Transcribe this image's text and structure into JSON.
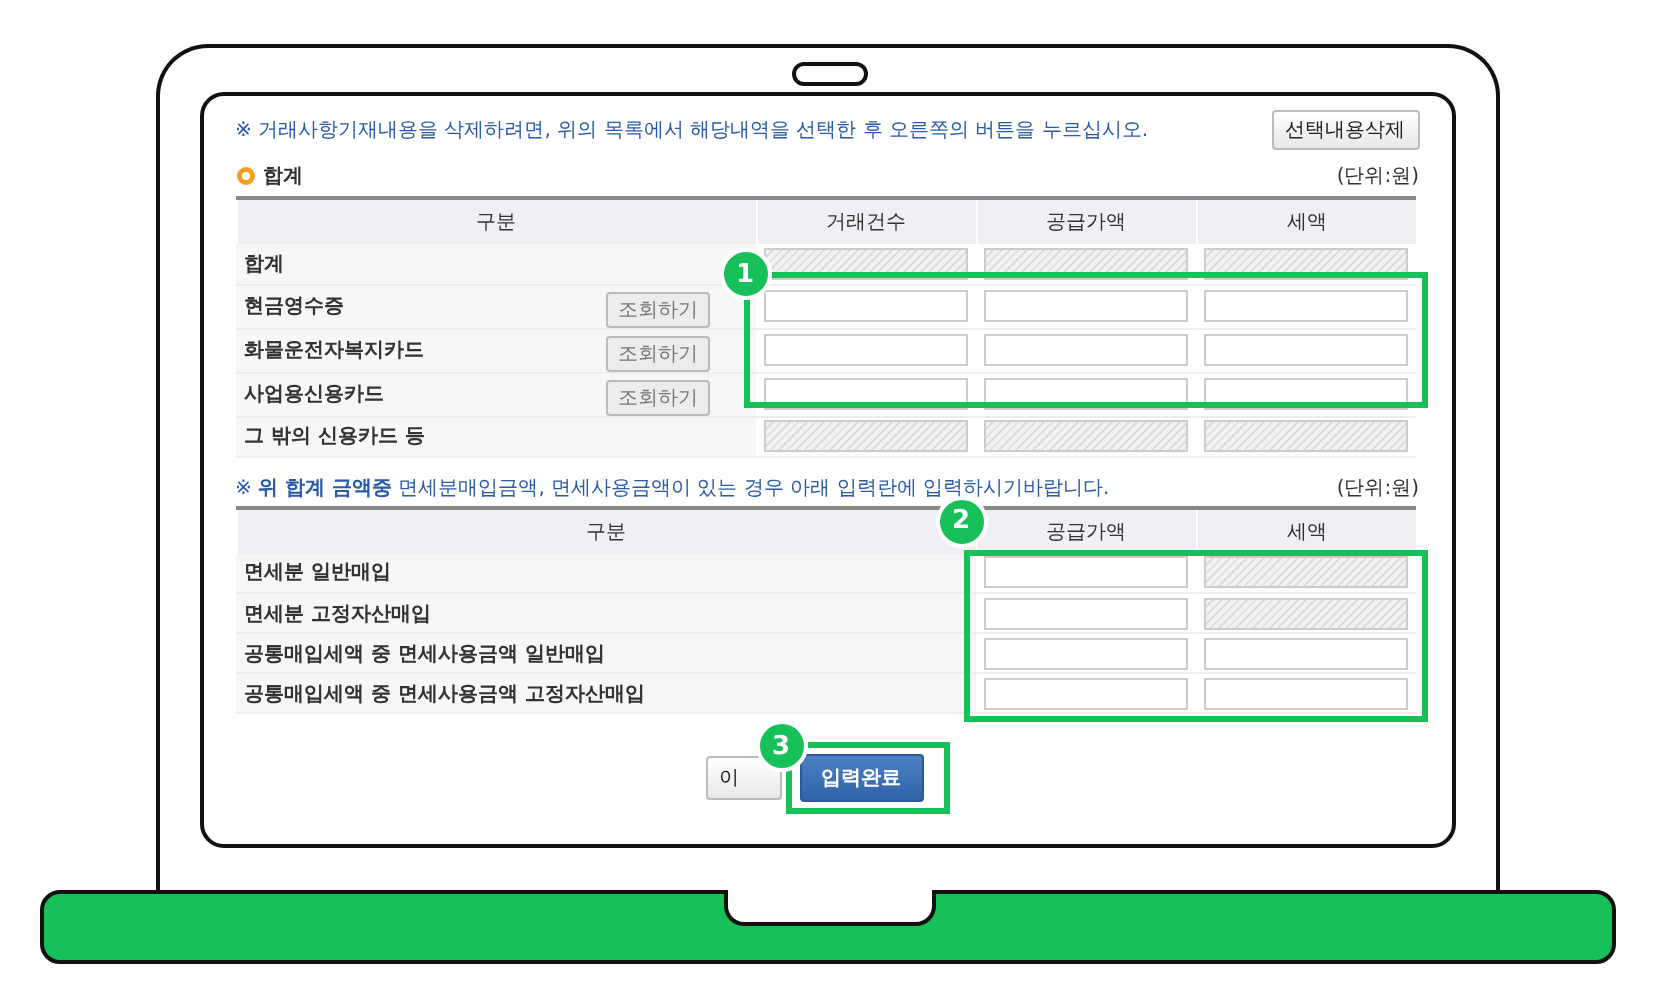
{
  "notice": "※ 거래사항기재내용을 삭제하려면, 위의 목록에서 해당내역을 선택한 후 오른쪽의 버튼을 누르십시오.",
  "delete_button": "선택내용삭제",
  "summary": {
    "title": "합계",
    "unit": "(단위:원)",
    "columns": [
      "구분",
      "거래건수",
      "공급가액",
      "세액"
    ],
    "callout": "1",
    "rows": [
      {
        "label": "합계",
        "fields": [
          {
            "disabled": true
          },
          {
            "disabled": true
          },
          {
            "disabled": true
          }
        ]
      },
      {
        "label": "현금영수증",
        "button": "조회하기",
        "fields": [
          {
            "disabled": false
          },
          {
            "disabled": false
          },
          {
            "disabled": false
          }
        ]
      },
      {
        "label": "화물운전자복지카드",
        "button": "조회하기",
        "fields": [
          {
            "disabled": false
          },
          {
            "disabled": false
          },
          {
            "disabled": false
          }
        ]
      },
      {
        "label": "사업용신용카드",
        "button": "조회하기",
        "fields": [
          {
            "disabled": false
          },
          {
            "disabled": false
          },
          {
            "disabled": false
          }
        ]
      },
      {
        "label": "그 밖의 신용카드 등",
        "fields": [
          {
            "disabled": true
          },
          {
            "disabled": true
          },
          {
            "disabled": true
          }
        ]
      }
    ]
  },
  "exempt": {
    "notice": "※ **위 합계 금액중** 면세분매입금액, 면세사용금액이 있는 경우 아래 입력란에 입력하시기바랍니다.",
    "unit": "(단위:원)",
    "columns": [
      "구분",
      "공급가액",
      "세액"
    ],
    "callout": "2",
    "rows": [
      {
        "label": "면세분 일반매입",
        "fields": [
          {
            "disabled": false
          },
          {
            "disabled": true
          }
        ]
      },
      {
        "label": "면세분 고정자산매입",
        "fields": [
          {
            "disabled": false
          },
          {
            "disabled": true
          }
        ]
      },
      {
        "label": "공통매입세액 중 면세사용금액 일반매입",
        "fields": [
          {
            "disabled": false
          },
          {
            "disabled": false
          }
        ]
      },
      {
        "label": "공통매입세액 중 면세사용금액 고정자산매입",
        "fields": [
          {
            "disabled": false
          },
          {
            "disabled": false
          }
        ]
      }
    ]
  },
  "actions": {
    "callout": "3",
    "buttons": [
      {
        "label": "이",
        "kind": "secondary"
      },
      {
        "label": "입력완료",
        "kind": "primary"
      }
    ]
  }
}
